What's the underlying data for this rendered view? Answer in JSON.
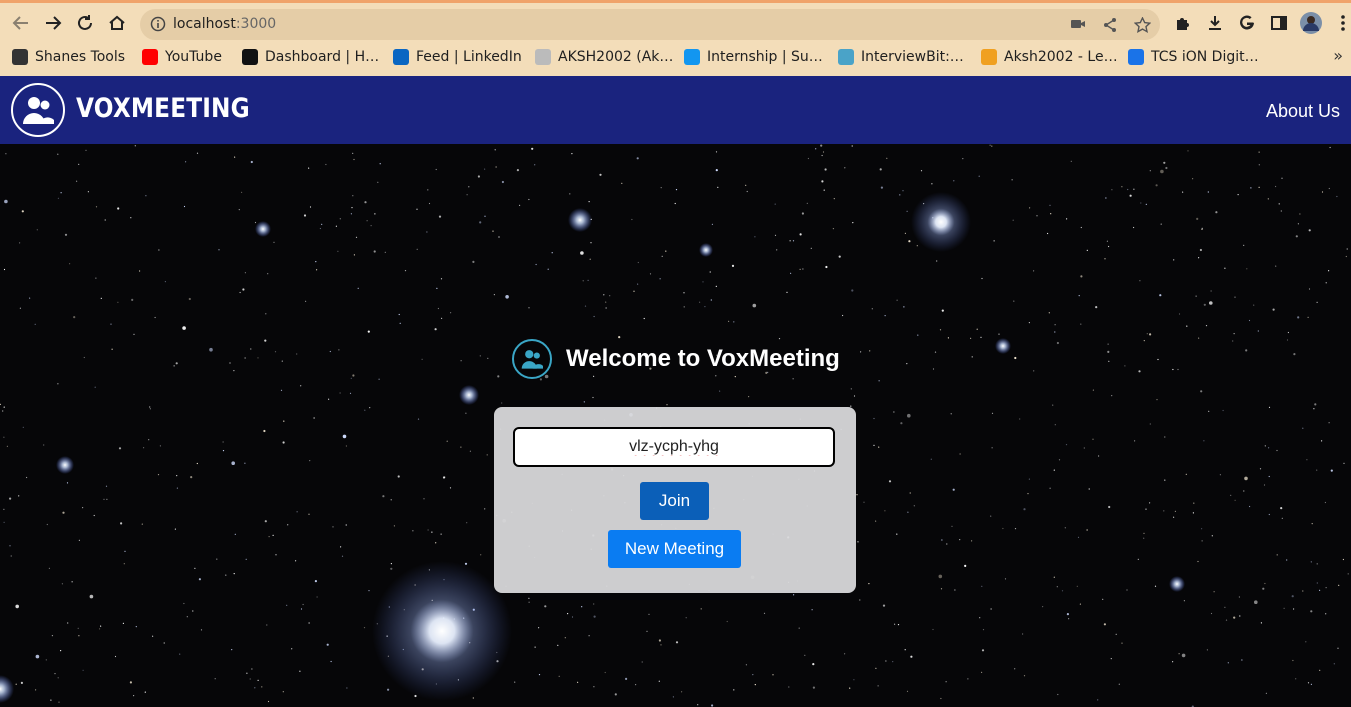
{
  "browser": {
    "url_host": "localhost",
    "url_port": ":3000",
    "bookmarks": [
      {
        "label": "Shanes Tools",
        "icon": "globe-icon",
        "color": "#333333"
      },
      {
        "label": "YouTube",
        "icon": "youtube-icon",
        "color": "#ff0000"
      },
      {
        "label": "Dashboard | H…",
        "icon": "hackerrank-icon",
        "color": "#111111"
      },
      {
        "label": "Feed | LinkedIn",
        "icon": "linkedin-icon",
        "color": "#0a66c2"
      },
      {
        "label": "AKSH2002 (Ak…",
        "icon": "github-icon",
        "color": "#bbbbbb"
      },
      {
        "label": "Internship | Su…",
        "icon": "internshala-icon",
        "color": "#1296f0"
      },
      {
        "label": "InterviewBit:…",
        "icon": "interviewbit-icon",
        "color": "#4aa3c8"
      },
      {
        "label": "Aksh2002 - Le…",
        "icon": "leetcode-icon",
        "color": "#f0a020"
      },
      {
        "label": "TCS iON Digit…",
        "icon": "tcs-ion-icon",
        "color": "#1a73e8"
      }
    ]
  },
  "navbar": {
    "brand": "VOXMEETING",
    "about": "About Us",
    "color": "#1a237e"
  },
  "main": {
    "welcome": "Welcome to VoxMeeting",
    "meeting_code": "vlz-ycph-yhg",
    "join_label": "Join",
    "new_meeting_label": "New Meeting"
  }
}
